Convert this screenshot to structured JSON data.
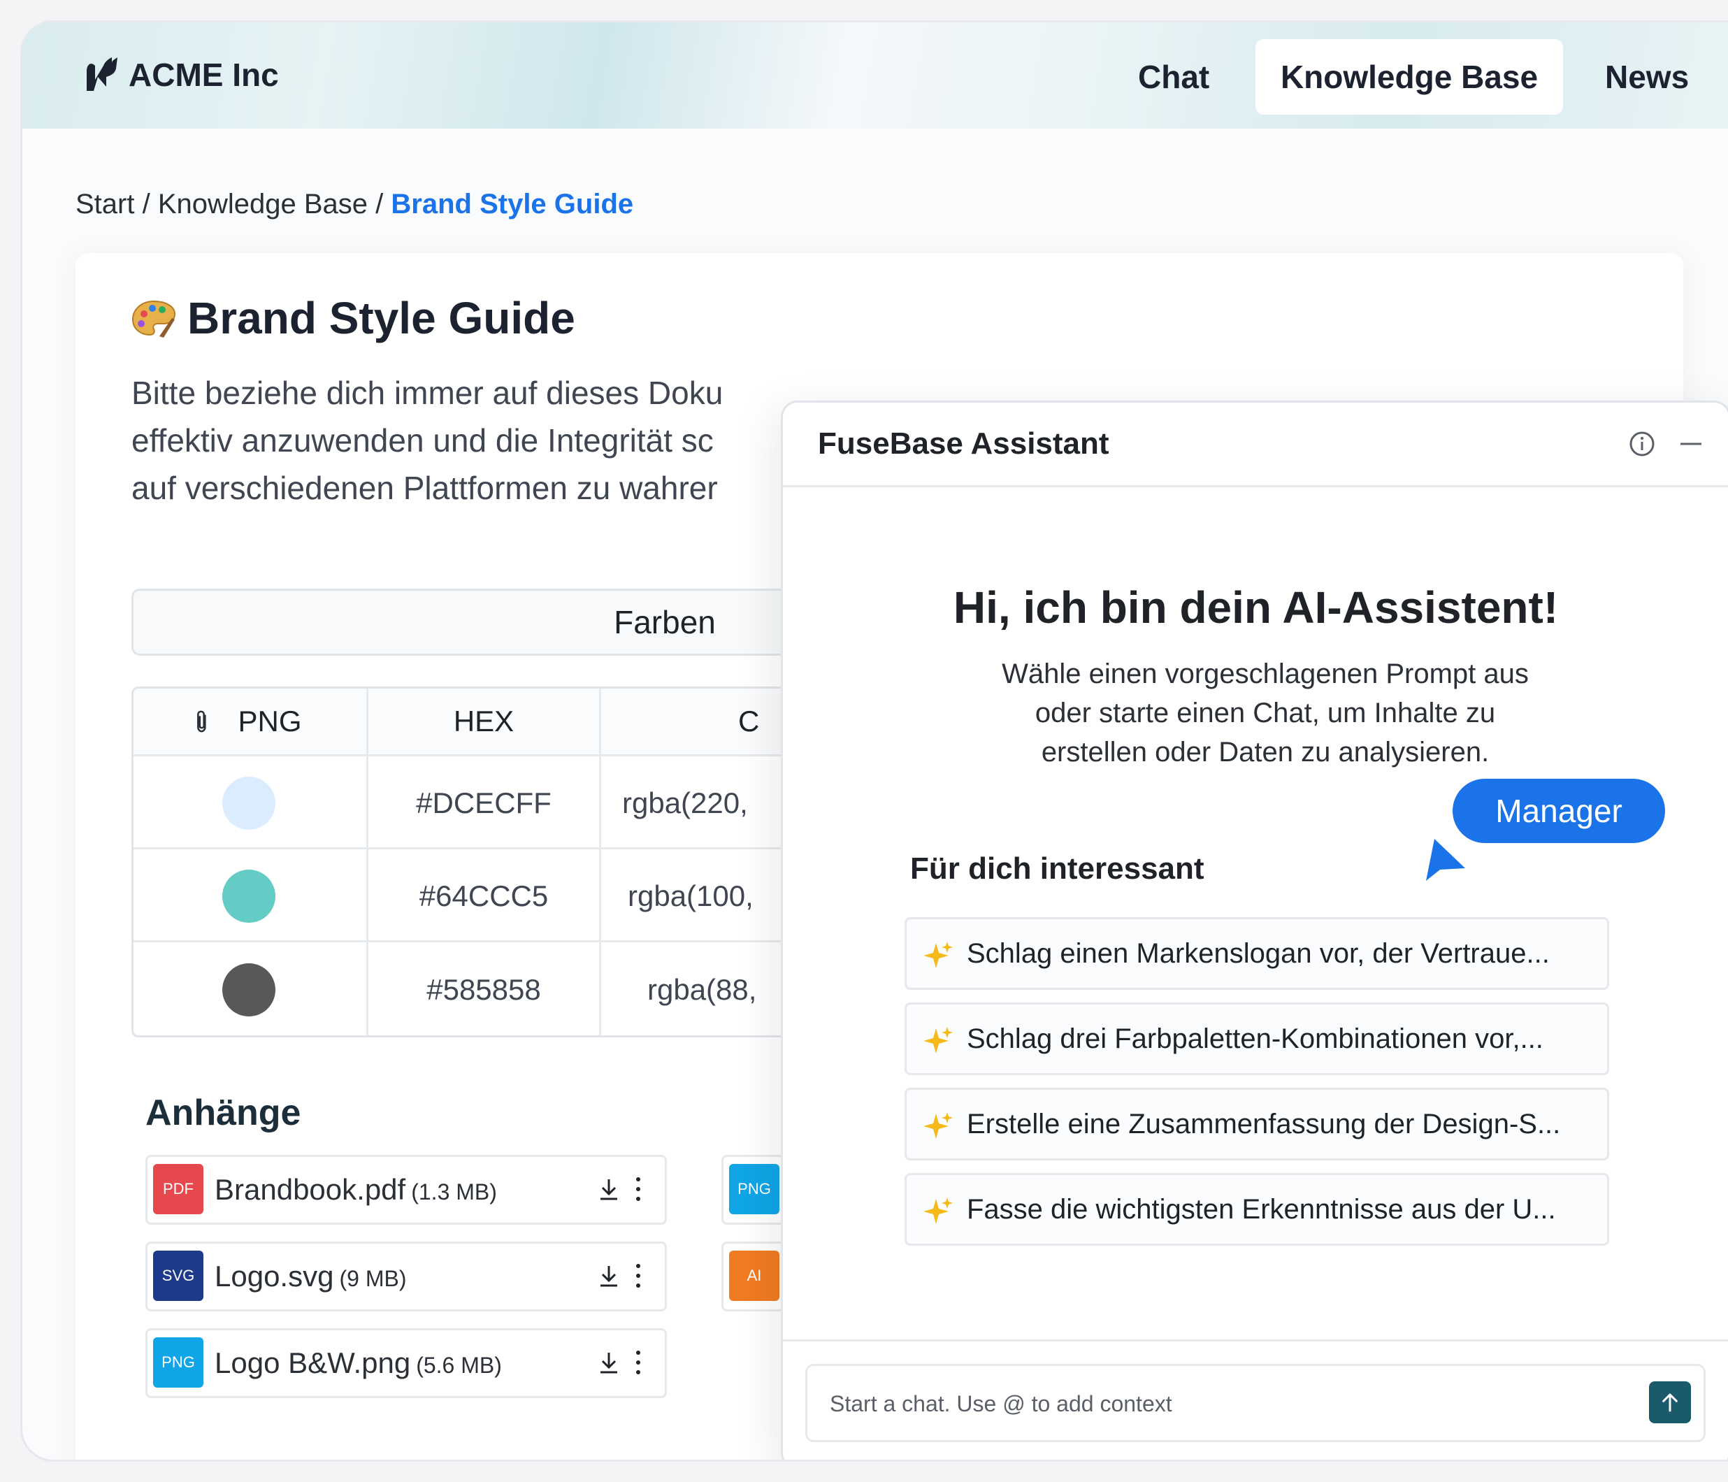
{
  "header": {
    "logo_text": "ACME Inc",
    "nav": [
      {
        "label": "Chat",
        "active": false
      },
      {
        "label": "Knowledge Base",
        "active": true
      },
      {
        "label": "News",
        "active": false
      }
    ]
  },
  "breadcrumb": {
    "items": [
      "Start",
      "Knowledge Base"
    ],
    "separator": " / ",
    "current": "Brand Style Guide"
  },
  "document": {
    "title": "Brand Style Guide",
    "title_icon": "palette-icon",
    "description": "Bitte beziehe dich immer auf dieses Doku\neffektiv anzuwenden und die Integrität sc\nauf verschiedenen Plattformen zu wahrer",
    "tab_label": "Farben",
    "colors_table": {
      "headers": [
        "PNG",
        "HEX",
        "C"
      ],
      "rows": [
        {
          "swatch": "#DCECFF",
          "hex": "#DCECFF",
          "rgba": "rgba(220,"
        },
        {
          "swatch": "#64CCC5",
          "hex": "#64CCC5",
          "rgba": "rgba(100,"
        },
        {
          "swatch": "#585858",
          "hex": "#585858",
          "rgba": "rgba(88,"
        }
      ]
    },
    "attachments_title": "Anhänge",
    "attachments": [
      {
        "badge": "PDF",
        "badge_color": "#e5484d",
        "name": "Brandbook.pdf",
        "size": "(1.3 MB)"
      },
      {
        "badge": "SVG",
        "badge_color": "#1e3a8a",
        "name": "Logo.svg",
        "size": "(9 MB)"
      },
      {
        "badge": "PNG",
        "badge_color": "#10a5e6",
        "name": "Logo B&W.png",
        "size": "(5.6 MB)"
      }
    ],
    "attachments_col2": [
      {
        "badge": "PNG",
        "badge_color": "#10a5e6"
      },
      {
        "badge": "AI",
        "badge_color": "#f07b22"
      }
    ]
  },
  "assistant": {
    "title": "FuseBase Assistant",
    "greeting": "Hi, ich bin dein AI-Assistent!",
    "subtitle": "Wähle einen vorgeschlagenen Prompt aus oder starte einen Chat, um Inhalte zu erstellen oder Daten zu analysieren.",
    "manager_label": "Manager",
    "section_title": "Für dich interessant",
    "prompts": [
      "Schlag einen Markenslogan vor, der Vertraue...",
      "Schlag drei Farbpaletten-Kombinationen vor,...",
      "Erstelle eine Zusammenfassung der Design-S...",
      "Fasse die wichtigsten Erkenntnisse aus der U..."
    ],
    "input_placeholder": "Start a chat. Use @ to add context"
  },
  "colors": {
    "accent": "#1a73e8",
    "send_button": "#1b5a6b"
  }
}
